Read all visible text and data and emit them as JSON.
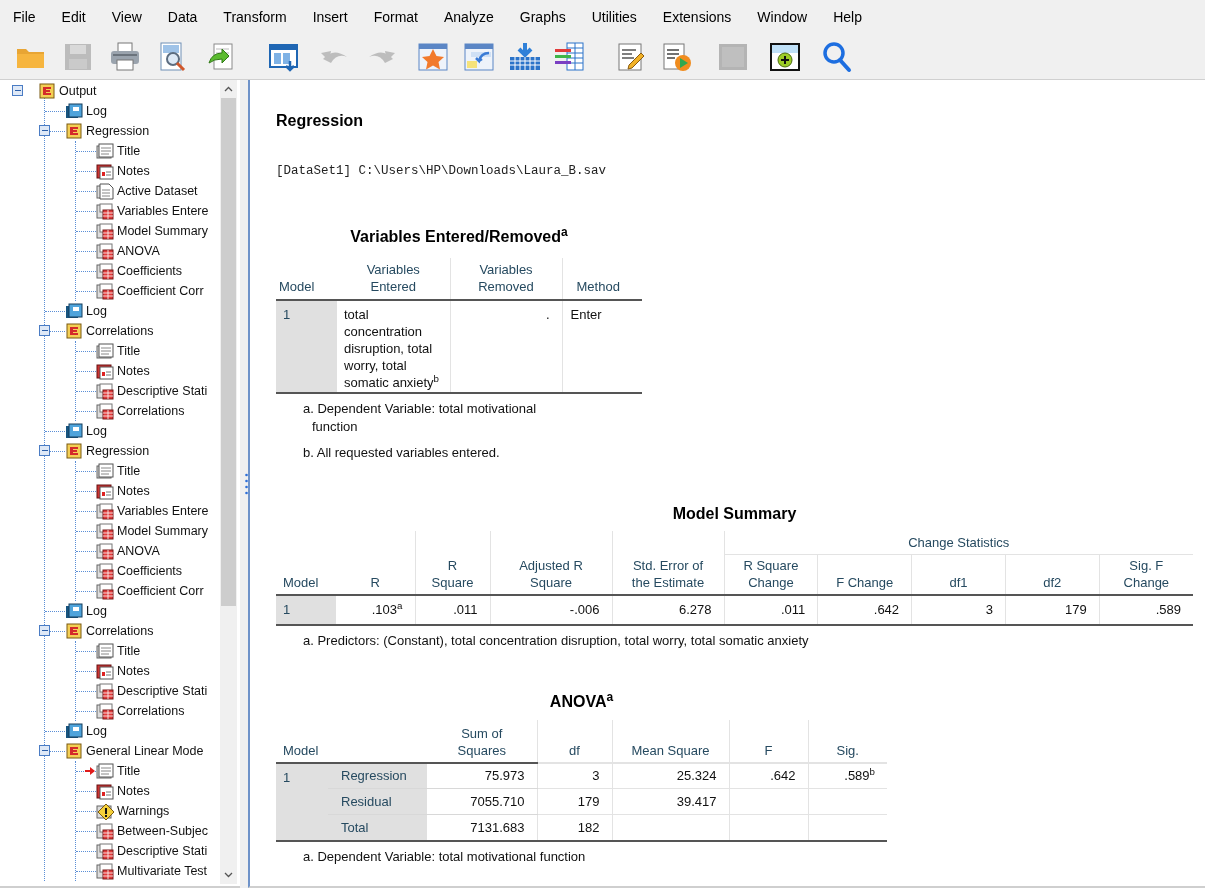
{
  "menu": [
    {
      "label": "File"
    },
    {
      "label": "Edit"
    },
    {
      "label": "View"
    },
    {
      "label": "Data"
    },
    {
      "label": "Transform"
    },
    {
      "label": "Insert"
    },
    {
      "label": "Format"
    },
    {
      "label": "Analyze"
    },
    {
      "label": "Graphs"
    },
    {
      "label": "Utilities"
    },
    {
      "label": "Extensions"
    },
    {
      "label": "Window"
    },
    {
      "label": "Help"
    }
  ],
  "toolbar": [
    {
      "kind": "open",
      "disabled": false
    },
    {
      "kind": "save",
      "disabled": true
    },
    {
      "kind": "print",
      "disabled": false
    },
    {
      "kind": "preview",
      "disabled": false
    },
    {
      "kind": "export",
      "disabled": false
    },
    {
      "kind": "dialog",
      "disabled": false
    },
    {
      "kind": "undo",
      "disabled": true
    },
    {
      "kind": "redo",
      "disabled": true
    },
    {
      "kind": "star",
      "disabled": false
    },
    {
      "kind": "gotocase",
      "disabled": false
    },
    {
      "kind": "variables",
      "disabled": false
    },
    {
      "kind": "list",
      "disabled": false
    },
    {
      "kind": "edit",
      "disabled": false
    },
    {
      "kind": "run",
      "disabled": false
    },
    {
      "kind": "blank",
      "disabled": true
    },
    {
      "kind": "designate",
      "disabled": false
    },
    {
      "kind": "search",
      "disabled": false
    }
  ],
  "tree": {
    "label": "Output",
    "kind": "output",
    "expanded": true,
    "current": false,
    "children": [
      {
        "label": "Log",
        "kind": "log",
        "current": false
      },
      {
        "label": "Regression",
        "kind": "output",
        "expanded": true,
        "current": false,
        "children": [
          {
            "label": "Title",
            "kind": "title",
            "current": false
          },
          {
            "label": "Notes",
            "kind": "notes",
            "current": false
          },
          {
            "label": "Active Dataset",
            "kind": "dataset",
            "current": false
          },
          {
            "label": "Variables Entere",
            "kind": "table",
            "current": false
          },
          {
            "label": "Model Summary",
            "kind": "table",
            "current": false
          },
          {
            "label": "ANOVA",
            "kind": "table",
            "current": false
          },
          {
            "label": "Coefficients",
            "kind": "table",
            "current": false
          },
          {
            "label": "Coefficient Corr",
            "kind": "table",
            "current": false
          }
        ]
      },
      {
        "label": "Log",
        "kind": "log",
        "current": false
      },
      {
        "label": "Correlations",
        "kind": "output",
        "expanded": true,
        "current": false,
        "children": [
          {
            "label": "Title",
            "kind": "title",
            "current": false
          },
          {
            "label": "Notes",
            "kind": "notes",
            "current": false
          },
          {
            "label": "Descriptive Stati",
            "kind": "table",
            "current": false
          },
          {
            "label": "Correlations",
            "kind": "table",
            "current": false
          }
        ]
      },
      {
        "label": "Log",
        "kind": "log",
        "current": false
      },
      {
        "label": "Regression",
        "kind": "output",
        "expanded": true,
        "current": false,
        "children": [
          {
            "label": "Title",
            "kind": "title",
            "current": false
          },
          {
            "label": "Notes",
            "kind": "notes",
            "current": false
          },
          {
            "label": "Variables Entere",
            "kind": "table",
            "current": false
          },
          {
            "label": "Model Summary",
            "kind": "table",
            "current": false
          },
          {
            "label": "ANOVA",
            "kind": "table",
            "current": false
          },
          {
            "label": "Coefficients",
            "kind": "table",
            "current": false
          },
          {
            "label": "Coefficient Corr",
            "kind": "table",
            "current": false
          }
        ]
      },
      {
        "label": "Log",
        "kind": "log",
        "current": false
      },
      {
        "label": "Correlations",
        "kind": "output",
        "expanded": true,
        "current": false,
        "children": [
          {
            "label": "Title",
            "kind": "title",
            "current": false
          },
          {
            "label": "Notes",
            "kind": "notes",
            "current": false
          },
          {
            "label": "Descriptive Stati",
            "kind": "table",
            "current": false
          },
          {
            "label": "Correlations",
            "kind": "table",
            "current": false
          }
        ]
      },
      {
        "label": "Log",
        "kind": "log",
        "current": false
      },
      {
        "label": "General Linear Mode",
        "kind": "output",
        "expanded": true,
        "current": false,
        "children": [
          {
            "label": "Title",
            "kind": "title",
            "current": true
          },
          {
            "label": "Notes",
            "kind": "notes",
            "current": false
          },
          {
            "label": "Warnings",
            "kind": "warning",
            "current": false
          },
          {
            "label": "Between-Subjec",
            "kind": "table",
            "current": false
          },
          {
            "label": "Descriptive Stati",
            "kind": "table",
            "current": false
          },
          {
            "label": "Multivariate Test",
            "kind": "table",
            "current": false
          }
        ]
      }
    ]
  },
  "output": {
    "heading": "Regression",
    "dataset_line": "[DataSet1] C:\\Users\\HP\\Downloads\\Laura_B.sav",
    "variables_table": {
      "title": "Variables Entered/Removed$^{a}$",
      "columns": [
        "Model",
        "Variables Entered",
        "Variables Removed",
        "Method"
      ],
      "rows": [
        [
          "1",
          "total concentration disruption, total worry, total somatic anxiety$^{b}$",
          ".",
          "Enter"
        ]
      ],
      "footnotes": [
        "a. Dependent Variable: total motivational function",
        "b. All requested variables entered."
      ]
    },
    "model_summary": {
      "title": "Model Summary",
      "column_group": "Change Statistics",
      "columns": [
        "Model",
        "R",
        "R Square",
        "Adjusted R Square",
        "Std. Error of the Estimate",
        "R Square Change",
        "F Change",
        "df1",
        "df2",
        "Sig. F Change"
      ],
      "rows": [
        [
          "1",
          ".103$^{a}$",
          ".011",
          "-.006",
          "6.278",
          ".011",
          ".642",
          "3",
          "179",
          ".589"
        ]
      ],
      "footnotes": [
        "a. Predictors: (Constant), total concentration disruption, total worry, total somatic anxiety"
      ]
    },
    "anova": {
      "title": "ANOVA$^{a}$",
      "stub_header": "Model",
      "columns": [
        "Sum of Squares",
        "df",
        "Mean Square",
        "F",
        "Sig."
      ],
      "model": "1",
      "rows": [
        {
          "label": "Regression",
          "cells": [
            "75.973",
            "3",
            "25.324",
            ".642",
            ".589$^{b}$"
          ]
        },
        {
          "label": "Residual",
          "cells": [
            "7055.710",
            "179",
            "39.417"
          ]
        },
        {
          "label": "Total",
          "cells": [
            "7131.683",
            "182"
          ]
        }
      ],
      "footnotes": [
        "a. Dependent Variable: total motivational function"
      ]
    }
  }
}
